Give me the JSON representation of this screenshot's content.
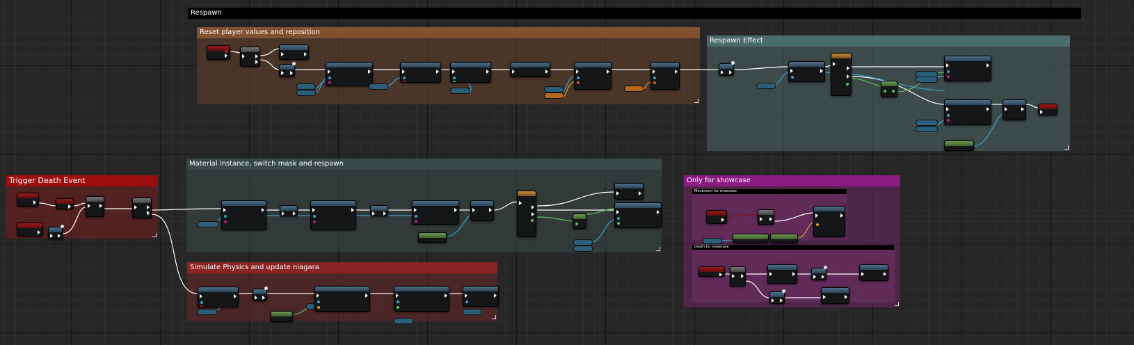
{
  "comments": {
    "respawn": "Respawn",
    "reset": "Reset player values and reposition",
    "respawn_effect": "Respawn Effect",
    "material": "Material instance, switch mask and respawn",
    "trigger": "Trigger Death Event",
    "showcase": "Only for showcase",
    "simulate": "Simulate Physics and update niagara"
  },
  "subcomments": {
    "movement": "Movement for showcase",
    "death": "Death for showcase"
  },
  "colors": {
    "background": "#262626",
    "exec_wire": "#ffffff",
    "object_wire": "#3aa0d0",
    "vector_wire": "#d8a020",
    "bool_wire": "#8b1010",
    "float_wire": "#60c060"
  }
}
